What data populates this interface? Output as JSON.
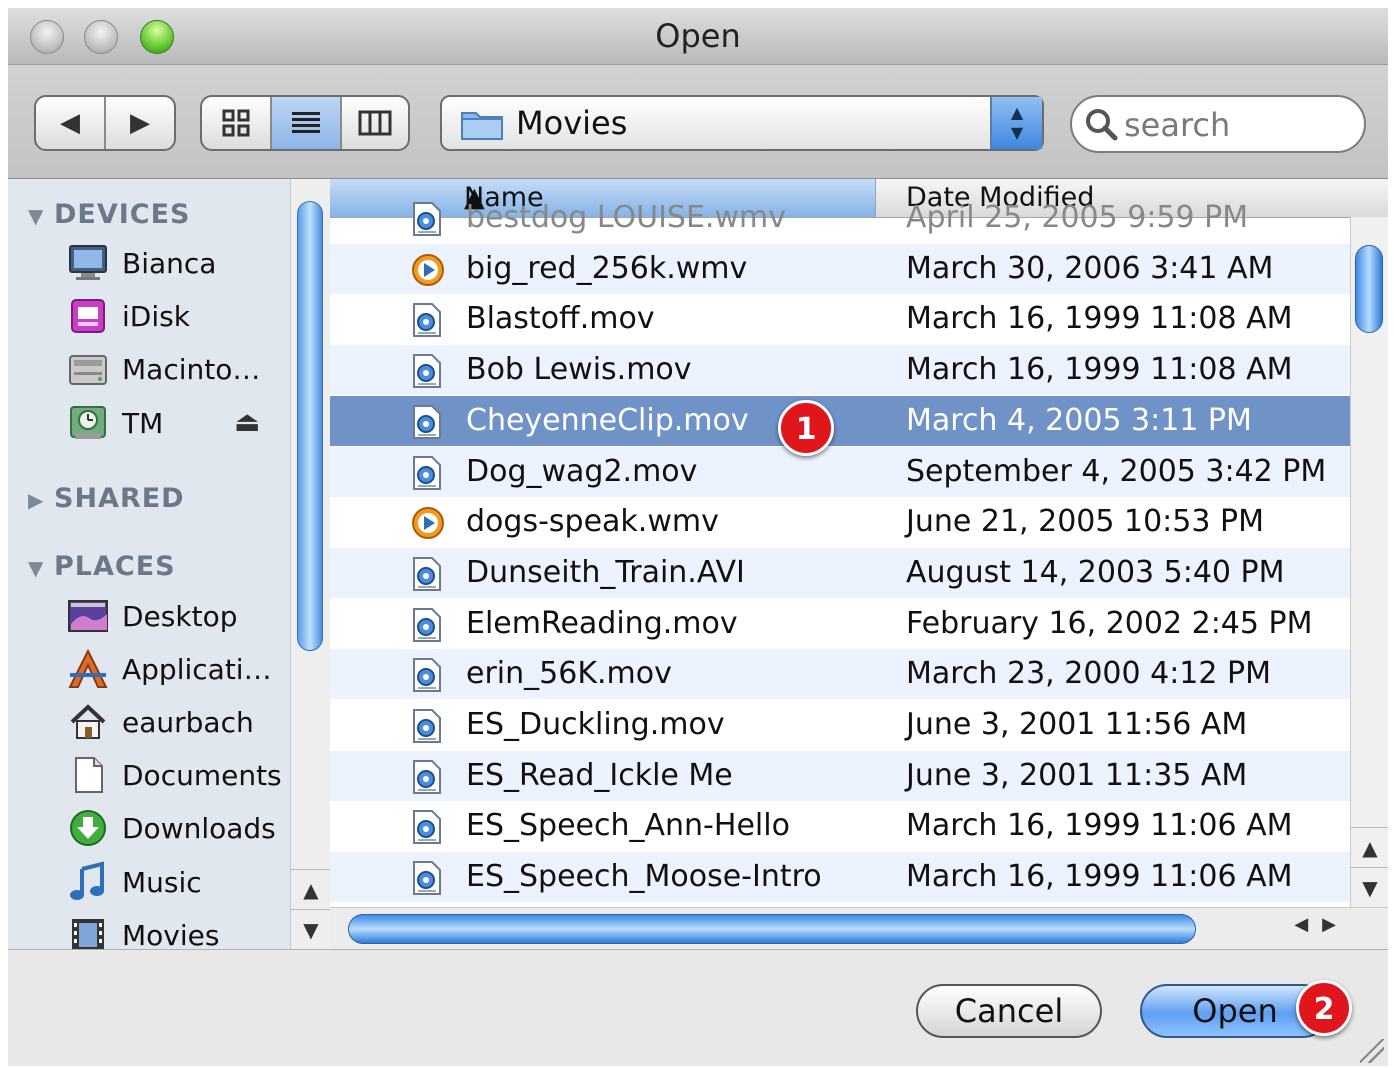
{
  "window": {
    "title": "Open"
  },
  "toolbar": {
    "back": "◀",
    "forward": "▶",
    "location": "Movies",
    "search_placeholder": "search"
  },
  "sidebar": {
    "devices_header": "DEVICES",
    "devices": [
      {
        "label": "Bianca",
        "icon": "computer-icon"
      },
      {
        "label": "iDisk",
        "icon": "idisk-icon"
      },
      {
        "label": "Macinto…",
        "icon": "hard-drive-icon"
      },
      {
        "label": "TM",
        "icon": "time-machine-drive-icon"
      }
    ],
    "eject": "⏏",
    "shared_header": "SHARED",
    "places_header": "PLACES",
    "places": [
      {
        "label": "Desktop",
        "icon": "desktop-icon"
      },
      {
        "label": "Applicati…",
        "icon": "applications-icon"
      },
      {
        "label": "eaurbach",
        "icon": "home-icon"
      },
      {
        "label": "Documents",
        "icon": "documents-icon"
      },
      {
        "label": "Downloads",
        "icon": "downloads-icon"
      },
      {
        "label": "Music",
        "icon": "music-icon"
      },
      {
        "label": "Movies",
        "icon": "movies-icon"
      }
    ]
  },
  "file_list": {
    "columns": {
      "name": "Name",
      "date": "Date Modified"
    },
    "rows": [
      {
        "name": "bestdog LOUISE.wmv",
        "date": "April 25, 2005 9:59 PM",
        "type": "quicktime"
      },
      {
        "name": "big_red_256k.wmv",
        "date": "March 30, 2006 3:41 AM",
        "type": "wmv"
      },
      {
        "name": "Blastoff.mov",
        "date": "March 16, 1999 11:08 AM",
        "type": "quicktime"
      },
      {
        "name": "Bob Lewis.mov",
        "date": "March 16, 1999 11:08 AM",
        "type": "quicktime"
      },
      {
        "name": "CheyenneClip.mov",
        "date": "March 4, 2005 3:11 PM",
        "type": "quicktime",
        "selected": true
      },
      {
        "name": "Dog_wag2.mov",
        "date": "September 4, 2005 3:42 PM",
        "type": "quicktime"
      },
      {
        "name": "dogs-speak.wmv",
        "date": "June 21, 2005 10:53 PM",
        "type": "wmv"
      },
      {
        "name": "Dunseith_Train.AVI",
        "date": "August 14, 2003 5:40 PM",
        "type": "quicktime"
      },
      {
        "name": "ElemReading.mov",
        "date": "February 16, 2002 2:45 PM",
        "type": "quicktime"
      },
      {
        "name": "erin_56K.mov",
        "date": "March 23, 2000 4:12 PM",
        "type": "quicktime"
      },
      {
        "name": "ES_Duckling.mov",
        "date": "June 3, 2001 11:56 AM",
        "type": "quicktime"
      },
      {
        "name": "ES_Read_Ickle Me",
        "date": "June 3, 2001 11:35 AM",
        "type": "quicktime"
      },
      {
        "name": "ES_Speech_Ann-Hello",
        "date": "March 16, 1999 11:06 AM",
        "type": "quicktime"
      },
      {
        "name": "ES_Speech_Moose-Intro",
        "date": "March 16, 1999 11:06 AM",
        "type": "quicktime"
      }
    ]
  },
  "footer": {
    "cancel_label": "Cancel",
    "open_label": "Open"
  },
  "callouts": {
    "first": "1",
    "second": "2"
  },
  "colors": {
    "selection": "#6f92c7",
    "accent": "#3f86de",
    "badge": "#e0161c",
    "alt_row": "#edf3fe"
  }
}
